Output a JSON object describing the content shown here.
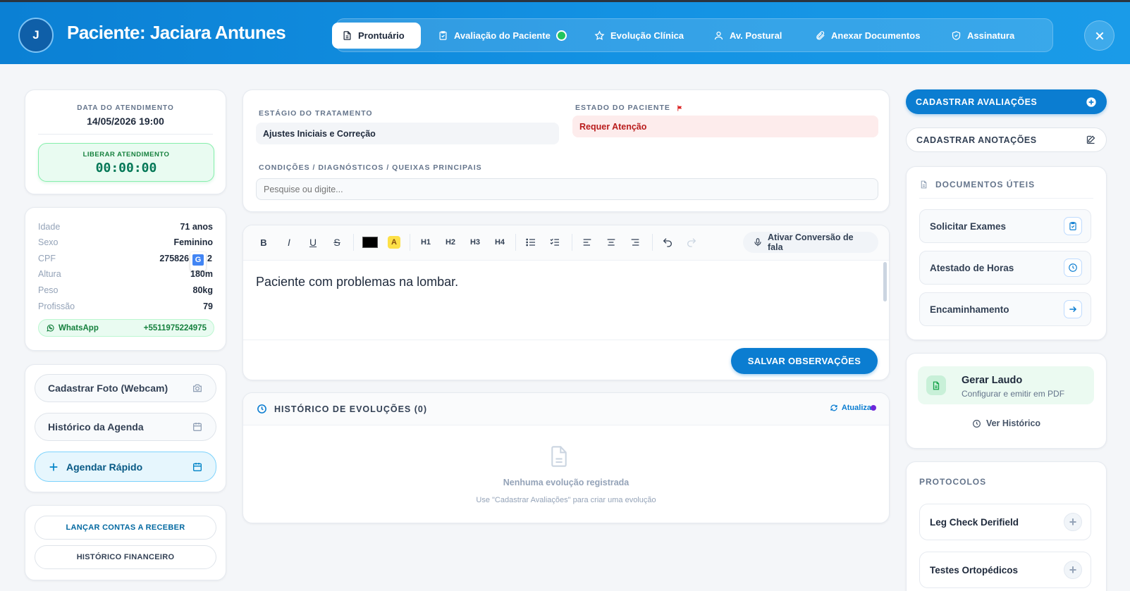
{
  "header": {
    "avatar_initial": "J",
    "patient_title": "Paciente: Jaciara Antunes",
    "tabs": [
      {
        "label": "Prontuário",
        "icon": "file-icon",
        "active": true
      },
      {
        "label": "Avaliação do Paciente",
        "icon": "clipboard-check-icon",
        "status": "green"
      },
      {
        "label": "Evolução Clínica",
        "icon": "star-icon"
      },
      {
        "label": "Av. Postural",
        "icon": "user-icon"
      },
      {
        "label": "Anexar Documentos",
        "icon": "paperclip-icon"
      },
      {
        "label": "Assinatura",
        "icon": "shield-check-icon"
      }
    ]
  },
  "attendance": {
    "date_label": "DATA DO ATENDIMENTO",
    "date_value": "14/05/2026 19:00",
    "release_label": "LIBERAR ATENDIMENTO",
    "timer": "00:00:00"
  },
  "patient_info": {
    "rows": [
      {
        "key": "Idade",
        "value": "71 anos"
      },
      {
        "key": "Sexo",
        "value": "Feminino"
      },
      {
        "key": "CPF",
        "value": "275826"
      },
      {
        "key": "Altura",
        "value": "180m"
      },
      {
        "key": "Peso",
        "value": "80kg"
      },
      {
        "key": "Profissão",
        "value": "79"
      }
    ],
    "cpf_tail": "2",
    "whatsapp_label": "WhatsApp",
    "whatsapp_number": "+5511975224975"
  },
  "actions": {
    "photo": "Cadastrar Foto (Webcam)",
    "agenda_history": "Histórico da Agenda",
    "quick_schedule": "Agendar Rápido"
  },
  "finance": {
    "receivables": "LANÇAR CONTAS A RECEBER",
    "history": "HISTÓRICO FINANCEIRO"
  },
  "treatment": {
    "stage_label": "ESTÁGIO DO TRATAMENTO",
    "stage_value": "Ajustes Iniciais e Correção",
    "state_label": "ESTADO DO PACIENTE",
    "state_value": "Requer Atenção",
    "conditions_label": "CONDIÇÕES / DIAGNÓSTICOS / QUEIXAS PRINCIPAIS",
    "conditions_placeholder": "Pesquise ou digite..."
  },
  "editor": {
    "toolbar": {
      "bold": "B",
      "italic": "I",
      "underline": "U",
      "strike": "S",
      "highlight": "A",
      "h1": "H1",
      "h2": "H2",
      "h3": "H3",
      "h4": "H4",
      "speech": "Ativar Conversão de fala"
    },
    "text_color": "#000000",
    "highlight_color": "#fde047",
    "content": "Paciente com problemas na lombar.",
    "save_label": "SALVAR OBSERVAÇÕES"
  },
  "history": {
    "title": "HISTÓRICO DE EVOLUÇÕES (0)",
    "refresh": "Atualiza",
    "empty_title": "Nenhuma evolução registrada",
    "empty_hint": "Use \"Cadastrar Avaliações\" para criar uma evolução"
  },
  "right": {
    "register_evaluations": "CADASTRAR AVALIAÇÕES",
    "register_notes": "CADASTRAR ANOTAÇÕES",
    "docs_title": "DOCUMENTOS ÚTEIS",
    "docs": [
      {
        "label": "Solicitar Exames",
        "icon": "clipboard-icon"
      },
      {
        "label": "Atestado de Horas",
        "icon": "clock-icon"
      },
      {
        "label": "Encaminhamento",
        "icon": "arrow-right-icon"
      }
    ],
    "report_title": "Gerar Laudo",
    "report_sub": "Configurar e emitir em PDF",
    "report_history": "Ver Histórico",
    "protocols_title": "PROTOCOLOS",
    "protocols": [
      "Leg Check Derifield",
      "Testes Ortopédicos"
    ]
  },
  "colors": {
    "primary": "#0b7dd1",
    "success": "#22c55e",
    "danger": "#dc2626",
    "attention_bg": "#fdecec"
  }
}
